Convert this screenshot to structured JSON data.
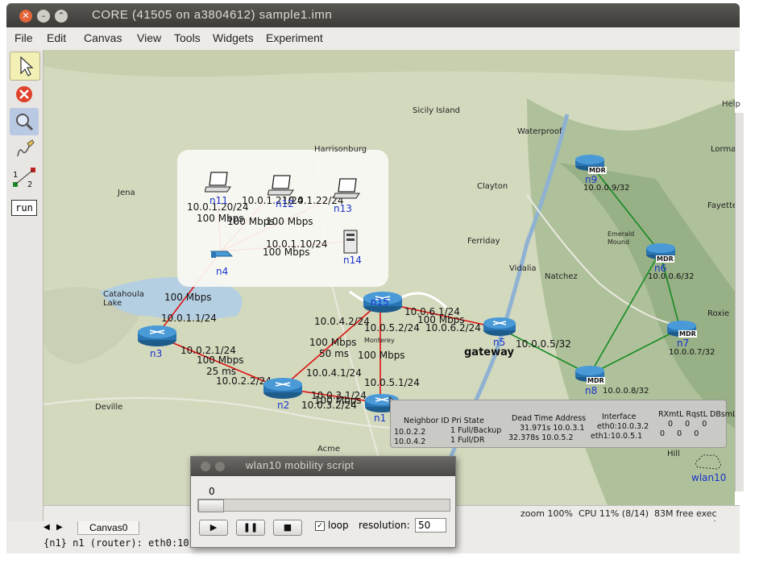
{
  "window": {
    "title": "CORE (41505 on a3804612) sample1.imn",
    "controls": [
      "close",
      "minimize",
      "maximize"
    ]
  },
  "menu": {
    "items": [
      "File",
      "Edit",
      "Canvas",
      "View",
      "Tools",
      "Widgets",
      "Experiment"
    ],
    "help": "Help"
  },
  "toolbar": {
    "tools": [
      {
        "name": "select-tool",
        "icon": "arrow-cursor-icon"
      },
      {
        "name": "stop-tool",
        "icon": "stop-icon"
      },
      {
        "name": "zoom-tool",
        "icon": "magnifier-icon"
      },
      {
        "name": "draw-tool",
        "icon": "pencil-icon"
      },
      {
        "name": "two-node-tool",
        "icon": "two-node-icon",
        "label_a": "1",
        "label_b": "2"
      },
      {
        "name": "run-tool",
        "icon": "run-icon",
        "label": "run"
      }
    ]
  },
  "map": {
    "places": {
      "sicily_island": "Sicily Island",
      "waterproof": "Waterproof",
      "harrisonburg": "Harrisonburg",
      "jena": "Jena",
      "clayton": "Clayton",
      "ferriday": "Ferriday",
      "vidalia": "Vidalia",
      "natchez": "Natchez",
      "catahoula": "Catahoula\nLake",
      "deville": "Deville",
      "acme": "Acme",
      "monterey": "Monterey",
      "emerald_mound": "Emerald\nMound",
      "fayette": "Fayette",
      "lorman": "Lorman",
      "roxie": "Roxie",
      "hill": "Hill"
    }
  },
  "nodes": {
    "n1": "n1",
    "n2": "n2",
    "n3": "n3",
    "n4": "n4",
    "n5": "n5",
    "n6": "n6",
    "n7": "n7",
    "n8": "n8",
    "n9": "n9",
    "n11": "n11",
    "n12": "n12",
    "n13": "n13",
    "n14": "n14",
    "n15": "n15",
    "gateway": "gateway",
    "wlan10": "wlan10",
    "mdr": "MDR"
  },
  "links": {
    "l1": "10.0.1.20/24",
    "l2": "10.0.1.21/24",
    "l3": "10.0.1.22/24",
    "l4": "100 Mbps",
    "l5": "100 Mbps",
    "l6": "100 Mbps",
    "l7": "10.0.1.10/24",
    "l8": "100 Mbps",
    "l9": "100 Mbps",
    "l10": "10.0.1.1/24",
    "l11": "10.0.2.1/24",
    "l12": "100 Mbps",
    "l13": "25 ms",
    "l14": "10.0.2.2/24",
    "l15": "10.0.4.2/24",
    "l16": "10.0.5.2/24",
    "l17": "100 Mbps",
    "l18": "50 ms",
    "l19": "100 Mbps",
    "l20": "10.0.4.1/24",
    "l21": "10.0.5.1/24",
    "l22": "10.0.3.1/24",
    "l23": "100 Mbps",
    "l24": "10.0.3.2/24",
    "l25": "10.0.6.1/24",
    "l26": "100 Mbps",
    "l27": "10.0.6.2/24",
    "l28": "10.0.0.5/32",
    "l29": "10.0.0.9/32",
    "l30": "10.0.0.6/32",
    "l31": "10.0.0.7/32",
    "l32": "10.0.0.8/32"
  },
  "ospf": {
    "h_neighbor": "Neighbor ID Pri State",
    "h_dead": "Dead Time Address",
    "h_iface": "Interface",
    "h_rx": "RXmtL RqstL DBsmL",
    "r1_id": "10.0.2.2",
    "r1_state": "1 Full/Backup",
    "r1_dead": "31.971s 10.0.3.1",
    "r1_iface": "eth0:10.0.3.2",
    "r1_rx": "0     0     0",
    "r2_id": "10.0.4.2",
    "r2_state": "1 Full/DR",
    "r2_dead": "32.378s 10.0.5.2",
    "r2_iface": "eth1:10.0.5.1",
    "r2_rx": "0     0     0"
  },
  "status": {
    "zoom": "zoom 100%",
    "cpu": "CPU 11% (8/14)",
    "mem": "83M free",
    "mode": "exec mode",
    "tab": "Canvas0",
    "cmdline": "{n1} n1 (router): eth0:10"
  },
  "dialog": {
    "title": "wlan10 mobility script",
    "time": "0",
    "loop_label": "loop",
    "loop_checked": true,
    "resolution_label": "resolution:",
    "resolution_value": "50",
    "progress_fraction": 0.0
  }
}
